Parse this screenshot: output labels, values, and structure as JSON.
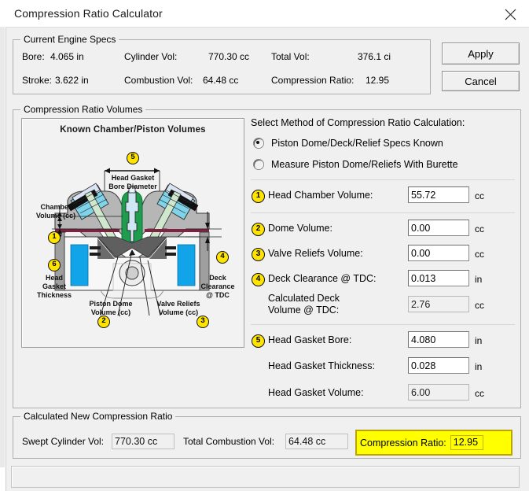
{
  "window": {
    "title": "Compression Ratio Calculator",
    "close_icon": "close-icon"
  },
  "specs_group": {
    "legend": "Current Engine Specs",
    "rows": [
      {
        "c1_label": "Bore:",
        "c1_value": "4.065 in",
        "c2_label": "Cylinder Vol:",
        "c2_value": "770.30 cc",
        "c3_label": "Total Vol:",
        "c3_value": "376.1 ci"
      },
      {
        "c1_label": "Stroke:",
        "c1_value": "3.622 in",
        "c2_label": "Combustion Vol:",
        "c2_value": "64.48 cc",
        "c3_label": "Compression Ratio:",
        "c3_value": "12.95"
      }
    ]
  },
  "buttons": {
    "apply": "Apply",
    "cancel": "Cancel"
  },
  "volumes_group": {
    "legend": "Compression Ratio Volumes"
  },
  "diagram": {
    "title": "Known Chamber/Piston Volumes",
    "labels": {
      "head_gasket_bore_diameter": "Head Gasket\nBore Diameter",
      "head_gasket_bore_diameter_l1": "Head Gasket",
      "head_gasket_bore_diameter_l2": "Bore Diameter",
      "chamber_volume_l1": "Chamber",
      "chamber_volume_l2": "Volume (cc)",
      "head_gasket_thickness_l1": "Head",
      "head_gasket_thickness_l2": "Gasket",
      "head_gasket_thickness_l3": "Thickness",
      "piston_dome_l1": "Piston Dome",
      "piston_dome_l2": "Volume (cc)",
      "valve_reliefs_l1": "Valve Reliefs",
      "valve_reliefs_l2": "Volume (cc)",
      "deck_clearance_l1": "Deck",
      "deck_clearance_l2": "Clearance",
      "deck_clearance_l3": "@ TDC"
    },
    "badges": {
      "b1": "1",
      "b2": "2",
      "b3": "3",
      "b4": "4",
      "b5": "5",
      "b6": "6"
    }
  },
  "method": {
    "title": "Select Method of Compression Ratio Calculation:",
    "options": [
      {
        "label": "Piston Dome/Deck/Relief Specs Known",
        "selected": true
      },
      {
        "label": "Measure Piston Dome/Reliefs With Burette",
        "selected": false
      }
    ]
  },
  "fields": [
    {
      "badge": "1",
      "label": "Head Chamber Volume:",
      "value": "55.72",
      "unit": "cc",
      "readonly": false
    },
    {
      "badge": "2",
      "label": "Dome Volume:",
      "value": "0.00",
      "unit": "cc",
      "readonly": false
    },
    {
      "badge": "3",
      "label": "Valve Reliefs Volume:",
      "value": "0.00",
      "unit": "cc",
      "readonly": false
    },
    {
      "badge": "4",
      "label": "Deck Clearance @ TDC:",
      "value": "0.013",
      "unit": "in",
      "readonly": false
    },
    {
      "badge": "",
      "label_l1": "Calculated Deck",
      "label_l2": "Volume @ TDC:",
      "value": "2.76",
      "unit": "cc",
      "readonly": true
    },
    {
      "badge": "5",
      "label": "Head Gasket Bore:",
      "value": "4.080",
      "unit": "in",
      "readonly": false
    },
    {
      "badge": "",
      "label": "Head Gasket Thickness:",
      "value": "0.028",
      "unit": "in",
      "readonly": false
    },
    {
      "badge": "",
      "label": "Head Gasket Volume:",
      "value": "6.00",
      "unit": "cc",
      "readonly": true
    }
  ],
  "result_group": {
    "legend": "Calculated New Compression Ratio",
    "swept_label": "Swept Cylinder Vol:",
    "swept_value": "770.30 cc",
    "total_label": "Total Combustion Vol:",
    "total_value": "64.48 cc",
    "ratio_label": "Compression Ratio:",
    "ratio_value": "12.95",
    "highlight_color": "#ffff00"
  },
  "statusbar": {
    "text": ""
  }
}
